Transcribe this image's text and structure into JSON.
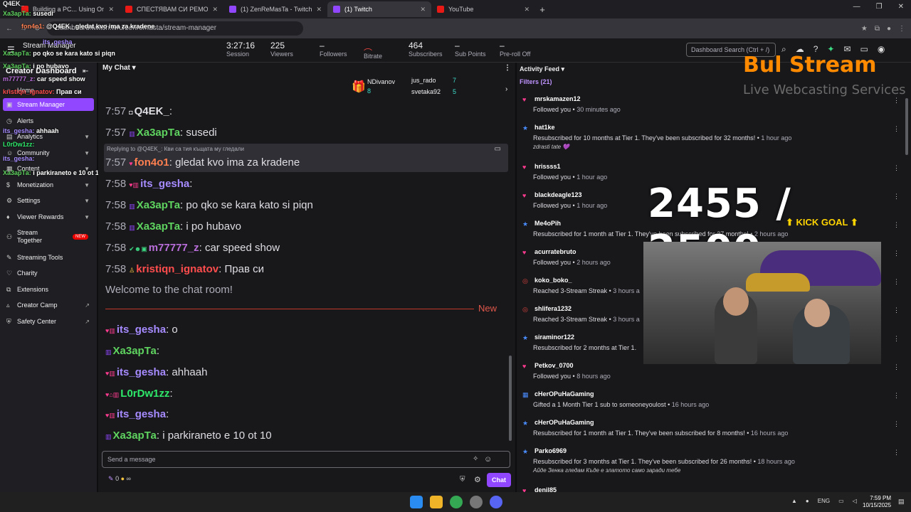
{
  "browser": {
    "tabs": [
      {
        "label": "Building a PC... Using Only the",
        "icon": "youtube-icon"
      },
      {
        "label": "СПЕСТЯВАМ СИ РЕМОНТ ЗА 3",
        "icon": "youtube-icon"
      },
      {
        "label": "(1) ZenReMasTa - Twitch",
        "icon": "twitch-icon"
      },
      {
        "label": "(1) Twitch",
        "icon": "twitch-icon"
      },
      {
        "label": "YouTube",
        "icon": "youtube-icon"
      }
    ],
    "url": "dashboard.twitch.tv/u/zenremasta/stream-manager"
  },
  "topnav": {
    "title": "Stream Manager",
    "stats": [
      {
        "value": "3:27:16",
        "label": "Session"
      },
      {
        "value": "225",
        "label": "Viewers"
      },
      {
        "value": "–",
        "label": "Followers"
      },
      {
        "value": "",
        "label": "Bitrate"
      },
      {
        "value": "464",
        "label": "Subscribers"
      },
      {
        "value": "–",
        "label": "Sub Points"
      },
      {
        "value": "–",
        "label": "Pre-roll Off"
      }
    ],
    "search_placeholder": "Dashboard Search (Ctrl + /)"
  },
  "sidebar": {
    "title": "Creator Dashboard",
    "items": [
      {
        "label": "Home"
      },
      {
        "label": "Stream Manager"
      },
      {
        "label": "Alerts"
      },
      {
        "label": "Analytics"
      },
      {
        "label": "Community"
      },
      {
        "label": "Content"
      },
      {
        "label": "Monetization"
      },
      {
        "label": "Settings"
      },
      {
        "label": "Viewer Rewards"
      },
      {
        "label": "Stream Together",
        "badge": "NEW"
      },
      {
        "label": "Streaming Tools"
      },
      {
        "label": "Charity"
      },
      {
        "label": "Extensions"
      },
      {
        "label": "Creator Camp"
      },
      {
        "label": "Safety Center"
      }
    ]
  },
  "overlay_chat": [
    {
      "user": "Q4EK_",
      "text": ""
    },
    {
      "user": "Ха3арТа",
      "text": "susedi"
    },
    {
      "user": "fon4o1",
      "text": "@Q4EK_ gledat kvo ima za kradene"
    },
    {
      "user": "its_gesha",
      "text": ""
    },
    {
      "user": "Ха3арТа",
      "text": "po qko se kara kato si piqn"
    },
    {
      "user": "Ха3арТа",
      "text": "i po hubavo"
    },
    {
      "user": "m77777_z",
      "text": "car speed show"
    },
    {
      "user": "kristiqn_ignatov",
      "text": "Прав си"
    },
    {
      "user": "its_gesha",
      "text": "ahhaah"
    },
    {
      "user": "L0rDw1zz",
      "text": ""
    },
    {
      "user": "its_gesha",
      "text": ""
    },
    {
      "user": "Ха3арТа",
      "text": "i parkiraneto e 10 ot 10"
    }
  ],
  "chat": {
    "title": "My Chat",
    "hype": [
      {
        "name": "NDivanov",
        "count": "8"
      },
      {
        "name": "jus_rado",
        "count": "7"
      },
      {
        "name": "svetaka92",
        "count": "5"
      }
    ],
    "reply_to": "Replying to @Q4EK_: Кви са тия къщата му гледали",
    "messages_old": [
      {
        "time": "7:57",
        "user": "Q4EK_",
        "color": "#efeff1",
        "text": ""
      },
      {
        "time": "7:57",
        "user": "Ха3арТа",
        "color": "#5fd35f",
        "text": "susedi"
      },
      {
        "time": "7:57",
        "user": "fon4o1",
        "color": "#ff7f50",
        "text": "gledat kvo ima za kradene"
      },
      {
        "time": "7:58",
        "user": "its_gesha",
        "color": "#a68bff",
        "text": ""
      },
      {
        "time": "7:58",
        "user": "Ха3арТа",
        "color": "#5fd35f",
        "text": "po qko se kara kato si piqn"
      },
      {
        "time": "7:58",
        "user": "Ха3арТа",
        "color": "#5fd35f",
        "text": "i po hubavo"
      },
      {
        "time": "7:58",
        "user": "m77777_z",
        "color": "#b96ed9",
        "text": "car speed show"
      },
      {
        "time": "7:58",
        "user": "kristiqn_ignatov",
        "color": "#ff4d4d",
        "text": "Прав си"
      }
    ],
    "welcome": "Welcome to the chat room!",
    "new_label": "New",
    "messages_new": [
      {
        "user": "its_gesha",
        "color": "#a68bff",
        "text": "o"
      },
      {
        "user": "Ха3арТа",
        "color": "#5fd35f",
        "text": ""
      },
      {
        "user": "its_gesha",
        "color": "#a68bff",
        "text": "ahhaah"
      },
      {
        "user": "L0rDw1zz",
        "color": "#2ee86a",
        "text": ""
      },
      {
        "user": "its_gesha",
        "color": "#a68bff",
        "text": ""
      },
      {
        "user": "Ха3арТа",
        "color": "#5fd35f",
        "text": "i parkiraneto e 10 ot 10"
      }
    ],
    "input_placeholder": "Send a message",
    "points": "0",
    "points2": "∞",
    "chat_button": "Chat"
  },
  "feed": {
    "title": "Activity Feed",
    "filters": "Filters (21)",
    "items": [
      {
        "icon": "heart",
        "name": "mrskamazen12",
        "pre": "Followed you",
        "time": "30 minutes ago"
      },
      {
        "icon": "star",
        "name": "hat1ke",
        "pre": "Resubscribed for 10 months at Tier 1. They've been subscribed for 32 months!",
        "time": "1 hour ago",
        "note": "zdrasti tate 💜"
      },
      {
        "icon": "heart",
        "name": "hrissss1",
        "pre": "Followed you",
        "time": "1 hour ago"
      },
      {
        "icon": "heart",
        "name": "blackdeagle123",
        "pre": "Followed you",
        "time": "1 hour ago"
      },
      {
        "icon": "star",
        "name": "Me4oPih",
        "pre": "Resubscribed for 1 month at Tier 1. They've been subscribed for 27 months!",
        "time": "2 hours ago"
      },
      {
        "icon": "heart",
        "name": "acurratebruto",
        "pre": "Followed you",
        "time": "2 hours ago"
      },
      {
        "icon": "streak",
        "name": "koko_boko_",
        "pre": "Reached 3-Stream Streak",
        "time": "3 hours a"
      },
      {
        "icon": "streak",
        "name": "shlifera1232",
        "pre": "Reached 3-Stream Streak",
        "time": "3 hours a"
      },
      {
        "icon": "star",
        "name": "siraminor122",
        "pre": "Resubscribed for 2 months at Tier 1.",
        "time": ""
      },
      {
        "icon": "heart",
        "name": "Petkov_0700",
        "pre": "Followed you",
        "time": "8 hours ago"
      },
      {
        "icon": "gift",
        "name": "cHerOPuHaGaming",
        "pre": "Gifted a 1 Month Tier 1 sub to someoneyoulost",
        "time": "16 hours ago"
      },
      {
        "icon": "star",
        "name": "cHerOPuHaGaming",
        "pre": "Resubscribed for 1 month at Tier 1. They've been subscribed for 8 months!",
        "time": "16 hours ago"
      },
      {
        "icon": "star",
        "name": "Parko6969",
        "pre": "Resubscribed for 3 months at Tier 1. They've been subscribed for 26 months!",
        "time": "18 hours ago",
        "note": "Айде Зенка гледам Къде е златото само заради тебе"
      },
      {
        "icon": "heart",
        "name": "denil85",
        "pre": "",
        "time": ""
      }
    ]
  },
  "overlay": {
    "goal": "2455 / 2500",
    "goal_label": "⬆ KICK GOAL ⬆",
    "logo": "Bul Stream",
    "logo_sub": "Live Webcasting Services"
  },
  "taskbar": {
    "lang": "ENG",
    "time": "7:59 PM",
    "date": "10/15/2025"
  },
  "colors": {
    "accent": "#9147ff",
    "follow": "#ff3b8f",
    "sub": "#4a8dff"
  }
}
